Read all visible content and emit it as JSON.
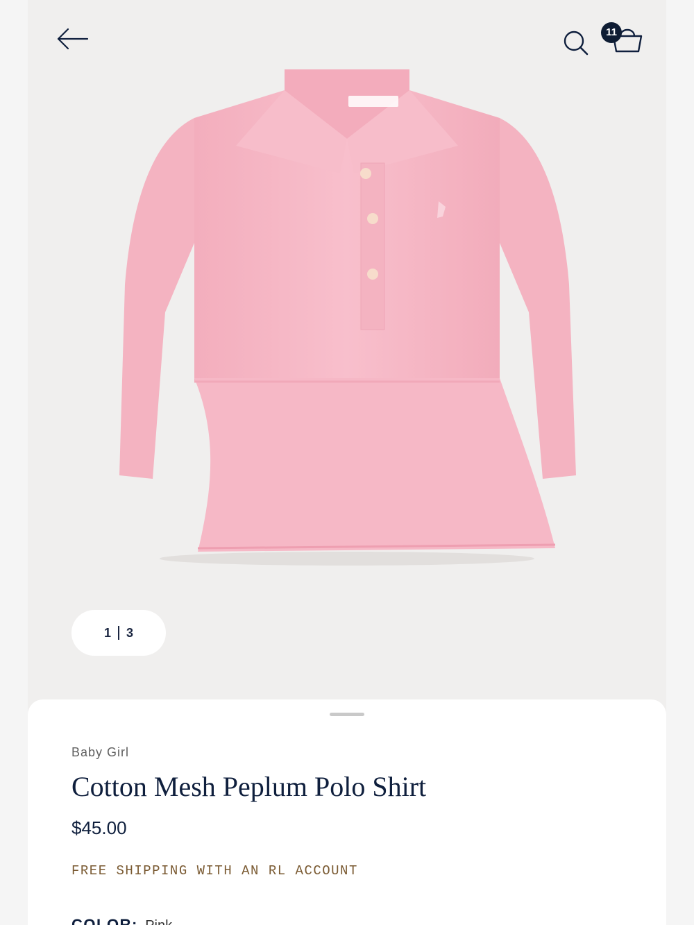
{
  "header": {
    "back_icon": "arrow-left-icon",
    "search_icon": "search-icon",
    "bag_icon": "shopping-bag-icon",
    "bag_count": "11"
  },
  "gallery": {
    "current": "1",
    "total": "3",
    "product_colors": {
      "shirt": "#f6b8c6",
      "button": "#f7dccb"
    }
  },
  "product": {
    "category": "Baby Girl",
    "name": "Cotton Mesh Peplum Polo Shirt",
    "price": "$45.00",
    "shipping_promo": "FREE SHIPPING WITH AN RL ACCOUNT",
    "color_label": "COLOR:",
    "color_value": "Pink"
  },
  "colors": {
    "brand_navy": "#0f1f3d",
    "promo_brown": "#7a5a32"
  }
}
